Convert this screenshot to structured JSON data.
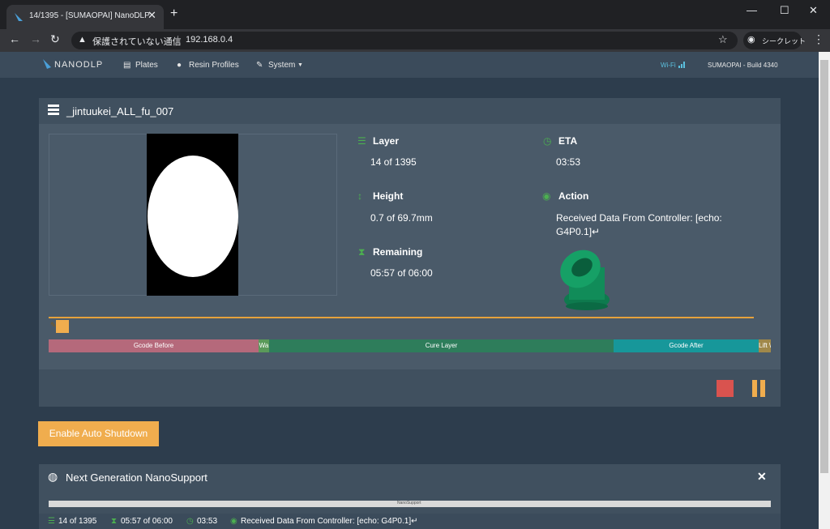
{
  "browser": {
    "tab_title": "14/1395 - [SUMAOPAI] NanoDLP",
    "security_label": "保護されていない通信",
    "url": "192.168.0.4",
    "incognito_label": "シークレット"
  },
  "nav": {
    "brand": "NANODLP",
    "items": [
      "Plates",
      "Resin Profiles",
      "System"
    ],
    "wifi": "Wi-Fi",
    "build": "SUMAOPAI - Build 4340"
  },
  "print": {
    "title": "_jintuukei_ALL_fu_007",
    "layer_label": "Layer",
    "layer_value": "14 of 1395",
    "eta_label": "ETA",
    "eta_value": "03:53",
    "height_label": "Height",
    "height_value": "0.7 of 69.7mm",
    "action_label": "Action",
    "action_value_line1": "Received Data From Controller: [echo:",
    "action_value_line2": "G4P0.1]↵",
    "remaining_label": "Remaining",
    "remaining_value": "05:57 of 06:00",
    "progress_fraction": 0.01
  },
  "phases": [
    {
      "label": "Gcode Before",
      "color": "#b5697b"
    },
    {
      "label": "Wa",
      "color": "#5a9a5a"
    },
    {
      "label": "Cure Layer",
      "color": "#2e7d5b"
    },
    {
      "label": "Gcode After",
      "color": "#17979a"
    },
    {
      "label": "Lift \\",
      "color": "#a0884a"
    }
  ],
  "auto_shutdown_label": "Enable Auto Shutdown",
  "support_panel_title": "Next Generation NanoSupport",
  "support_thumb_title": "NanoSupport",
  "status": {
    "layer": "14 of 1395",
    "remaining": "05:57 of 06:00",
    "eta": "03:53",
    "action": "Received Data From Controller: [echo: G4P0.1]↵"
  },
  "colors": {
    "accent_green": "#4caf50",
    "stop_red": "#d9534f",
    "pause_orange": "#f0ad4e"
  }
}
